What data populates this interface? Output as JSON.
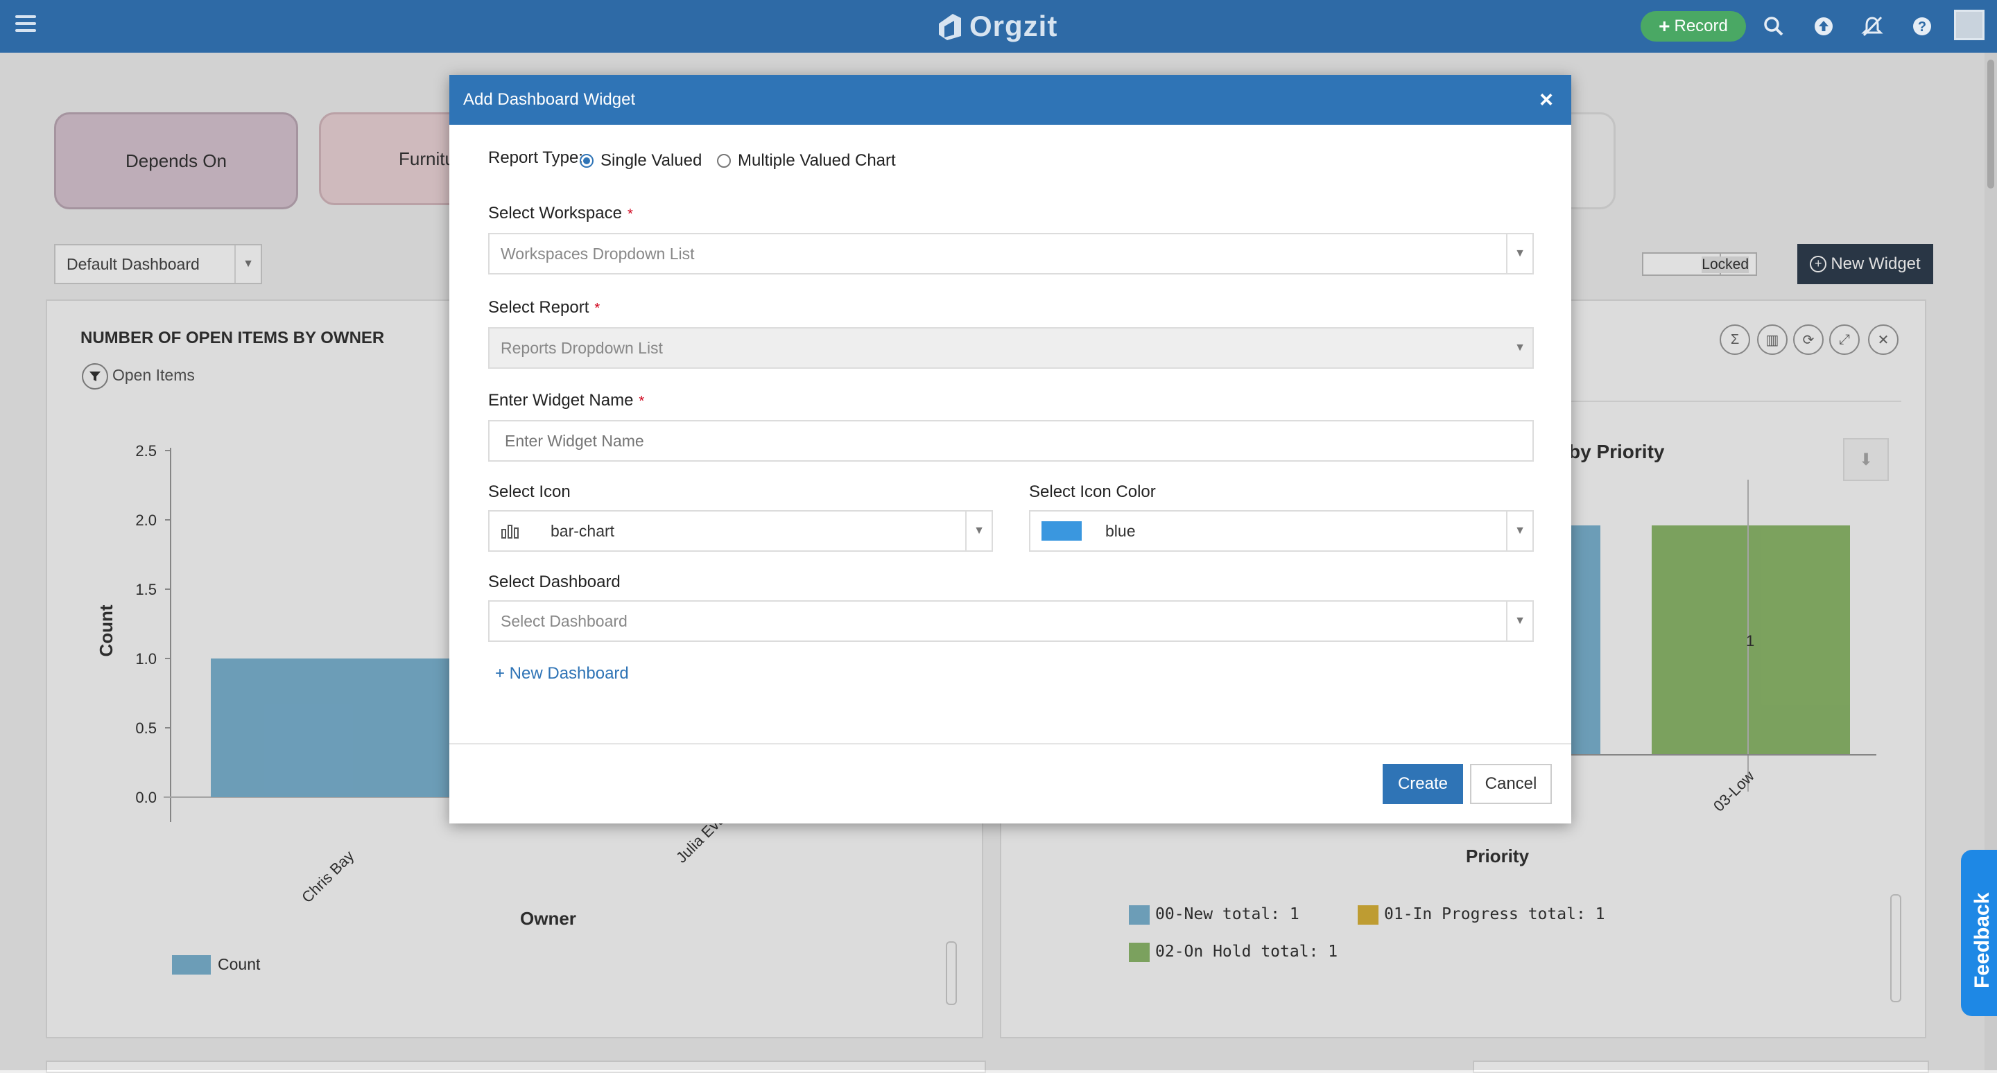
{
  "app": {
    "brand": "Orgzit",
    "record_label": "Record"
  },
  "tiles": [
    "Depends On",
    "Furnitu"
  ],
  "dashboard_select": {
    "value": "Default Dashboard"
  },
  "toolbar": {
    "locked_label": "Locked",
    "new_widget_label": "New Widget"
  },
  "left_panel": {
    "title": "NUMBER OF OPEN ITEMS BY OWNER",
    "filter_label": "Open Items",
    "ylabel": "Count",
    "xlabel": "Owner",
    "legend": "Count"
  },
  "right_panel": {
    "title_fragment": "by Priority",
    "xlabel": "Priority",
    "bar_label": "1",
    "tick_label": "03-Low",
    "legend": [
      "00-New total: 1",
      "01-In Progress total: 1",
      "02-On Hold total: 1"
    ]
  },
  "chart_data": [
    {
      "type": "bar",
      "title": "NUMBER OF OPEN ITEMS BY OWNER",
      "xlabel": "Owner",
      "ylabel": "Count",
      "categories": [
        "Chris Bay",
        "Julia Evans"
      ],
      "series": [
        {
          "name": "Count",
          "values": [
            1,
            1
          ]
        }
      ],
      "yticks": [
        "0.0",
        "0.5",
        "1.0",
        "1.5",
        "2.0",
        "2.5"
      ],
      "ylim": [
        0,
        2.5
      ]
    }
  ],
  "modal": {
    "title": "Add Dashboard Widget",
    "report_type_label": "Report Type:",
    "option_single": "Single Valued",
    "option_multiple": "Multiple Valued Chart",
    "workspace_label": "Select Workspace",
    "workspace_placeholder": "Workspaces Dropdown List",
    "report_label": "Select Report",
    "report_placeholder": "Reports Dropdown List",
    "widget_name_label": "Enter Widget Name",
    "widget_name_placeholder": "Enter Widget Name",
    "icon_label": "Select Icon",
    "icon_value": "bar-chart",
    "icon_color_label": "Select Icon Color",
    "icon_color_value": "blue",
    "dashboard_label": "Select Dashboard",
    "dashboard_placeholder": "Select Dashboard",
    "new_dashboard_link": "+ New Dashboard",
    "create_label": "Create",
    "cancel_label": "Cancel"
  },
  "feedback_label": "Feedback",
  "colors": {
    "header": "#2e6aa6",
    "modal_header": "#2f74b6",
    "record": "#4aa864",
    "bar_blue": "#7bb3d1",
    "bar_green": "#8db86b",
    "legend_yellow": "#d9b23a"
  }
}
